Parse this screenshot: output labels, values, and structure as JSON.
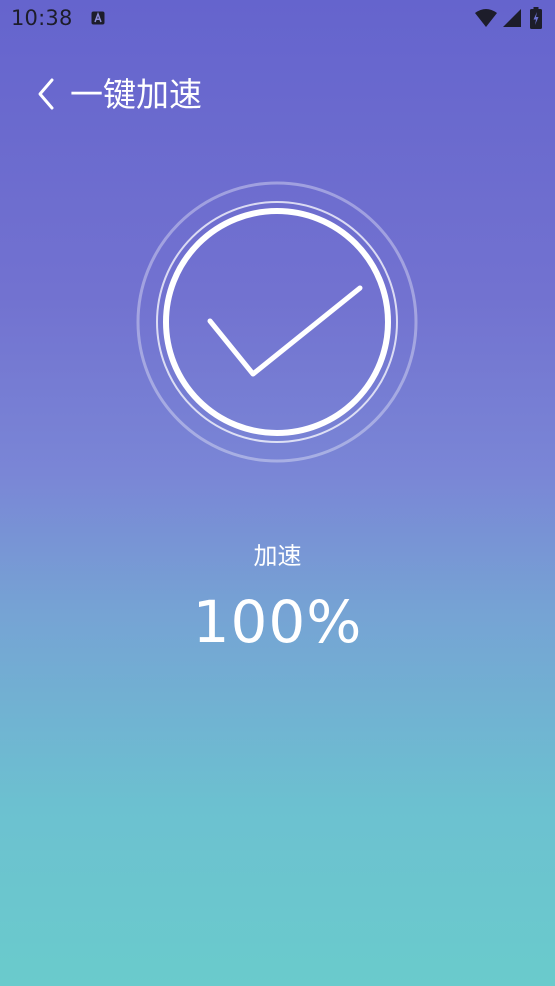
{
  "status_bar": {
    "time": "10:38",
    "app_icon": "a-box-icon",
    "wifi_icon": "wifi-icon",
    "signal_icon": "cell-signal-icon",
    "battery_icon": "battery-charging-icon"
  },
  "header": {
    "back_icon": "chevron-left-icon",
    "title": "一键加速"
  },
  "result": {
    "icon": "checkmark-circle-icon",
    "label": "加速",
    "percent": "100%"
  },
  "colors": {
    "gradient_top": "#6564cd",
    "gradient_middle": "#7a86d6",
    "gradient_bottom": "#6acbcc",
    "foreground": "#ffffff"
  }
}
